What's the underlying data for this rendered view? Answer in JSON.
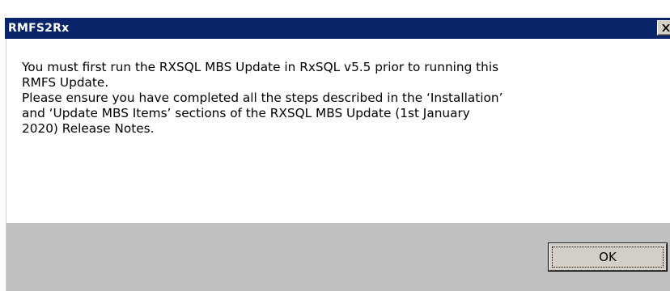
{
  "dialog": {
    "title": "RMFS2Rx",
    "message_lines": [
      "You must first run the RXSQL MBS Update in RxSQL v5.5 prior to running this",
      "RMFS Update.",
      "Please ensure you have completed all the steps described in the ‘Installation’",
      "and ‘Update MBS Items’ sections of the RXSQL MBS Update (1st January",
      "2020) Release Notes."
    ],
    "ok_label": "OK",
    "close_icon": "close-x-icon"
  },
  "colors": {
    "titlebar": "#0a246a",
    "title_text": "#ffffff",
    "content_bg": "#ffffff",
    "footer_bg": "#c0c0c0",
    "button_face": "#d4d0c8"
  }
}
